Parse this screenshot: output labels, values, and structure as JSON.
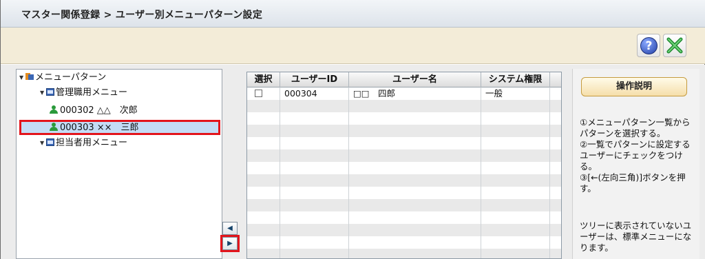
{
  "header": {
    "title": "マスター関係登録 > ユーザー別メニューパターン設定"
  },
  "toolbar": {
    "help_label": "?",
    "close_label": "✕"
  },
  "tree": {
    "root": {
      "label": "メニューパターン"
    },
    "groups": [
      {
        "label": "管理職用メニュー",
        "users": [
          {
            "label": "000302 △△　次郎",
            "selected": false
          },
          {
            "label": "000303 ××　三郎",
            "selected": true
          }
        ]
      },
      {
        "label": "担当者用メニュー",
        "users": []
      }
    ]
  },
  "move_buttons": {
    "left_icon": "◀",
    "right_icon": "▶"
  },
  "grid": {
    "columns": [
      "選択",
      "ユーザーID",
      "ユーザー名",
      "システム権限"
    ],
    "rows": [
      {
        "checked": false,
        "user_id": "000304",
        "user_name": "□□　四郎",
        "authority": "一般"
      }
    ]
  },
  "side": {
    "button_label": "操作説明",
    "note1": "①メニューパターン一覧からパターンを選択する。\n②一覧でパターンに設定するユーザーにチェックをつける。\n③[←(左向三角)]ボタンを押す。",
    "note2": "ツリーに表示されていないユーザーは、標準メニューになります。"
  },
  "colors": {
    "highlight": "#e3141b",
    "accent": "#3b67b5"
  }
}
